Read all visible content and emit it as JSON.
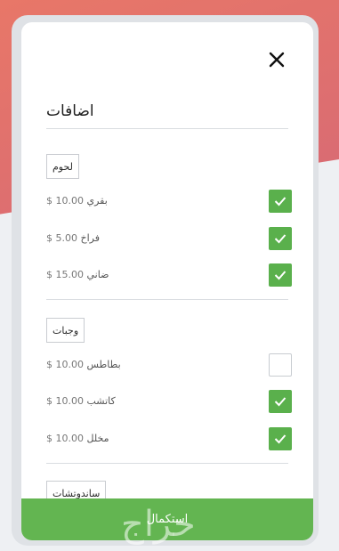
{
  "header": {
    "title": "اضافات"
  },
  "sections": [
    {
      "name": "لحوم",
      "items": [
        {
          "label": "بقري",
          "price": "$ 10.00",
          "checked": true
        },
        {
          "label": "فراخ",
          "price": "$ 5.00",
          "checked": true
        },
        {
          "label": "ضاني",
          "price": "$ 15.00",
          "checked": true
        }
      ]
    },
    {
      "name": "وجبات",
      "items": [
        {
          "label": "بطاطس",
          "price": "$ 10.00",
          "checked": false
        },
        {
          "label": "كاتشب",
          "price": "$ 10.00",
          "checked": true
        },
        {
          "label": "مخلل",
          "price": "$ 10.00",
          "checked": true
        }
      ]
    },
    {
      "name": "ساندوتشات",
      "items": []
    }
  ],
  "footer": {
    "submit_label": "استكمال"
  },
  "watermark": "حراج",
  "colors": {
    "accent": "#5ab04c",
    "button": "#63b551"
  }
}
